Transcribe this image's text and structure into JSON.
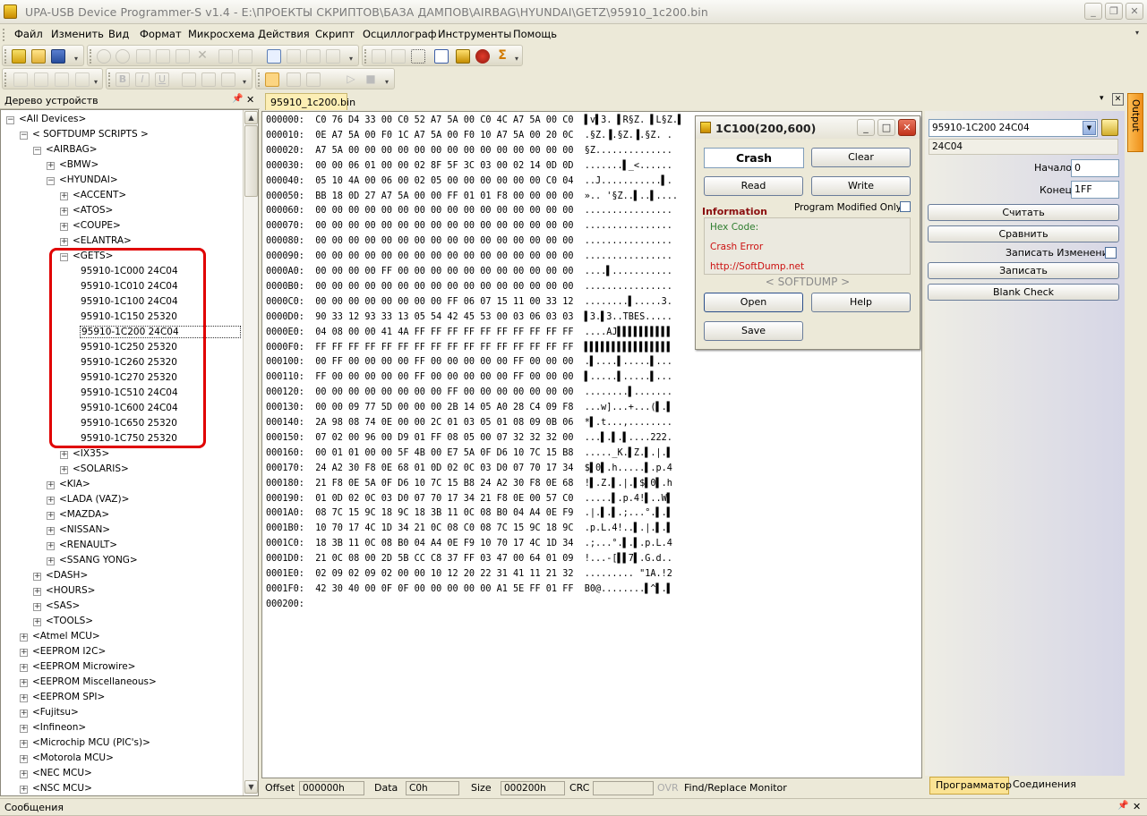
{
  "window": {
    "title": "UPA-USB Device Programmer-S v1.4 - E:\\ПРОЕКТЫ СКРИПТОВ\\БАЗА ДАМПОВ\\AIRBAG\\HYUNDAI\\GETZ\\95910_1c200.bin"
  },
  "menu": [
    "Файл",
    "Изменить",
    "Вид",
    "Формат",
    "Микросхема",
    "Действия",
    "Скрипт",
    "Осциллограф",
    "Инструменты",
    "Помощь"
  ],
  "tree_panel": {
    "title": "Дерево устройств"
  },
  "tree": [
    {
      "t": "<All Devices>",
      "lvl": 0,
      "box": "−"
    },
    {
      "t": "< SOFTDUMP SCRIPTS >",
      "lvl": 1,
      "box": "−"
    },
    {
      "t": "<AIRBAG>",
      "lvl": 2,
      "box": "−"
    },
    {
      "t": "<BMW>",
      "lvl": 3,
      "box": "+"
    },
    {
      "t": "<HYUNDAI>",
      "lvl": 3,
      "box": "−"
    },
    {
      "t": "<ACCENT>",
      "lvl": 4,
      "box": "+"
    },
    {
      "t": "<ATOS>",
      "lvl": 4,
      "box": "+"
    },
    {
      "t": "<COUPE>",
      "lvl": 4,
      "box": "+"
    },
    {
      "t": "<ELANTRA>",
      "lvl": 4,
      "box": "+"
    },
    {
      "t": "<GETS>",
      "lvl": 4,
      "box": "−"
    },
    {
      "t": "95910-1C000 24C04",
      "lvl": 5
    },
    {
      "t": "95910-1C010 24C04",
      "lvl": 5
    },
    {
      "t": "95910-1C100 24C04",
      "lvl": 5
    },
    {
      "t": "95910-1C150 25320",
      "lvl": 5
    },
    {
      "t": "95910-1C200 24C04",
      "lvl": 5,
      "sel": true
    },
    {
      "t": "95910-1C250 25320",
      "lvl": 5
    },
    {
      "t": "95910-1C260 25320",
      "lvl": 5
    },
    {
      "t": "95910-1C270 25320",
      "lvl": 5
    },
    {
      "t": "95910-1C510 24C04",
      "lvl": 5
    },
    {
      "t": "95910-1C600 24C04",
      "lvl": 5
    },
    {
      "t": "95910-1C650 25320",
      "lvl": 5
    },
    {
      "t": "95910-1C750 25320",
      "lvl": 5
    },
    {
      "t": "<IX35>",
      "lvl": 4,
      "box": "+"
    },
    {
      "t": "<SOLARIS>",
      "lvl": 4,
      "box": "+"
    },
    {
      "t": "<KIA>",
      "lvl": 3,
      "box": "+"
    },
    {
      "t": "<LADA (VAZ)>",
      "lvl": 3,
      "box": "+"
    },
    {
      "t": "<MAZDA>",
      "lvl": 3,
      "box": "+"
    },
    {
      "t": "<NISSAN>",
      "lvl": 3,
      "box": "+"
    },
    {
      "t": "<RENAULT>",
      "lvl": 3,
      "box": "+"
    },
    {
      "t": "<SSANG YONG>",
      "lvl": 3,
      "box": "+"
    },
    {
      "t": "<DASH>",
      "lvl": 2,
      "box": "+"
    },
    {
      "t": "<HOURS>",
      "lvl": 2,
      "box": "+"
    },
    {
      "t": "<SAS>",
      "lvl": 2,
      "box": "+"
    },
    {
      "t": "<TOOLS>",
      "lvl": 2,
      "box": "+"
    },
    {
      "t": "<Atmel MCU>",
      "lvl": 1,
      "box": "+"
    },
    {
      "t": "<EEPROM I2C>",
      "lvl": 1,
      "box": "+"
    },
    {
      "t": "<EEPROM Microwire>",
      "lvl": 1,
      "box": "+"
    },
    {
      "t": "<EEPROM Miscellaneous>",
      "lvl": 1,
      "box": "+"
    },
    {
      "t": "<EEPROM SPI>",
      "lvl": 1,
      "box": "+"
    },
    {
      "t": "<Fujitsu>",
      "lvl": 1,
      "box": "+"
    },
    {
      "t": "<Infineon>",
      "lvl": 1,
      "box": "+"
    },
    {
      "t": "<Microchip MCU (PIC's)>",
      "lvl": 1,
      "box": "+"
    },
    {
      "t": "<Motorola MCU>",
      "lvl": 1,
      "box": "+"
    },
    {
      "t": "<NEC MCU>",
      "lvl": 1,
      "box": "+"
    },
    {
      "t": "<NSC MCU>",
      "lvl": 1,
      "box": "+"
    }
  ],
  "doc_tab": "95910_1c200.bin",
  "hex_rows": [
    "000000:  C0 76 D4 33 00 C0 52 A7 5A 00 C0 4C A7 5A 00 C0  ▌v▌3. ▌R§Z. ▌L§Z.▌",
    "000010:  0E A7 5A 00 F0 1C A7 5A 00 F0 10 A7 5A 00 20 0C  .§Z.▐.§Z.▐.§Z. .",
    "000020:  A7 5A 00 00 00 00 00 00 00 00 00 00 00 00 00 00  §Z..............",
    "000030:  00 00 06 01 00 00 02 8F 5F 3C 03 00 02 14 0D 0D  .......▌_<......",
    "000040:  05 10 4A 00 06 00 02 05 00 00 00 00 00 00 C0 04  ..J...........▌.",
    "000050:  BB 18 0D 27 A7 5A 00 00 FF 01 01 F8 00 00 00 00  ».. '§Z..▌..▌....",
    "000060:  00 00 00 00 00 00 00 00 00 00 00 00 00 00 00 00  ................",
    "000070:  00 00 00 00 00 00 00 00 00 00 00 00 00 00 00 00  ................",
    "000080:  00 00 00 00 00 00 00 00 00 00 00 00 00 00 00 00  ................",
    "000090:  00 00 00 00 00 00 00 00 00 00 00 00 00 00 00 00  ................",
    "0000A0:  00 00 00 00 FF 00 00 00 00 00 00 00 00 00 00 00  ....▌...........",
    "0000B0:  00 00 00 00 00 00 00 00 00 00 00 00 00 00 00 00  ................",
    "0000C0:  00 00 00 00 00 00 00 00 FF 06 07 15 11 00 33 12  ........▌.....3.",
    "0000D0:  90 33 12 93 33 13 05 54 42 45 53 00 03 06 03 03  ▌3.▌3..TBES.....",
    "0000E0:  04 08 00 00 41 4A FF FF FF FF FF FF FF FF FF FF  ....AJ▌▌▌▌▌▌▌▌▌▌",
    "0000F0:  FF FF FF FF FF FF FF FF FF FF FF FF FF FF FF FF  ▌▌▌▌▌▌▌▌▌▌▌▌▌▌▌▌",
    "000100:  00 FF 00 00 00 00 FF 00 00 00 00 00 FF 00 00 00  .▌....▌.....▌...",
    "000110:  FF 00 00 00 00 00 FF 00 00 00 00 00 FF 00 00 00  ▌.....▌.....▌...",
    "000120:  00 00 00 00 00 00 00 00 FF 00 00 00 00 00 00 00  ........▌.......",
    "000130:  00 00 09 77 5D 00 00 00 2B 14 05 A0 28 C4 09 F8  ...w]...+...(▌.▌",
    "000140:  2A 98 08 74 0E 00 00 2C 01 03 05 01 08 09 0B 06  *▌.t...,........",
    "000150:  07 02 00 96 00 D9 01 FF 08 05 00 07 32 32 32 00  ...▌.▌.▌....222.",
    "000160:  00 01 01 00 00 5F 4B 00 E7 5A 0F D6 10 7C 15 B8  ....._K.▌Z.▌.|.▌",
    "000170:  24 A2 30 F8 0E 68 01 0D 02 0C 03 D0 07 70 17 34  $▌0▌.h.....▌.p.4",
    "000180:  21 F8 0E 5A 0F D6 10 7C 15 B8 24 A2 30 F8 0E 68  !▌.Z.▌.|.▌$▌0▌.h",
    "000190:  01 0D 02 0C 03 D0 07 70 17 34 21 F8 0E 00 57 C0  .....▌.p.4!▌..W▌",
    "0001A0:  08 7C 15 9C 18 9C 18 3B 11 0C 08 B0 04 A4 0E F9  .|.▌.▌.;...°.▌.▌",
    "0001B0:  10 70 17 4C 1D 34 21 0C 08 C0 08 7C 15 9C 18 9C  .p.L.4!..▌.|.▌.▌",
    "0001C0:  18 3B 11 0C 08 B0 04 A4 0E F9 10 70 17 4C 1D 34  .;...°.▌.▌.p.L.4",
    "0001D0:  21 0C 08 00 2D 5B CC C8 37 FF 03 47 00 64 01 09  !...-[▌▌7▌.G.d..",
    "0001E0:  02 09 02 09 02 00 00 10 12 20 22 31 41 11 21 32  ......... \"1A.!2",
    "0001F0:  42 30 40 00 0F 0F 00 00 00 00 00 A1 5E FF 01 FF  B0@........▌^▌.▌",
    "000200:"
  ],
  "status": {
    "offset_label": "Offset",
    "offset": "000000h",
    "data_label": "Data",
    "data": "C0h",
    "size_label": "Size",
    "size": "000200h",
    "crc_label": "CRC",
    "crc": "",
    "ovr": "OVR",
    "find": "Find/Replace",
    "monitor": "Monitor"
  },
  "plugin": {
    "title": "1C100(200,600)",
    "crash_field": "Crash",
    "clear": "Clear",
    "read": "Read",
    "write": "Write",
    "information": "Information",
    "pmo": "Program Modified Only",
    "hex_code": "Hex Code:",
    "crash_error": "Crash Error",
    "url": "http://SoftDump.net",
    "brand": "< SOFTDUMP >",
    "open": "Open",
    "help": "Help",
    "save": "Save"
  },
  "right": {
    "device_select": "95910-1C200 24C04",
    "chip": "24C04",
    "start_label": "Начало",
    "start": "0",
    "end_label": "Конец",
    "end": "1FF",
    "read_btn": "Считать",
    "compare_btn": "Сравнить",
    "write_changes": "Записать Изменение",
    "write_btn": "Записать",
    "blank_btn": "Blank Check",
    "tab_programmer": "Программатор",
    "tab_connections": "Соединения",
    "output_tab": "Output"
  },
  "messages_panel": {
    "title": "Сообщения"
  },
  "colors": {
    "highlight_red": "#e00000",
    "plugin_red": "#cc1111",
    "tab_orange": "#f5a623",
    "info_green": "#2e7d2e"
  }
}
